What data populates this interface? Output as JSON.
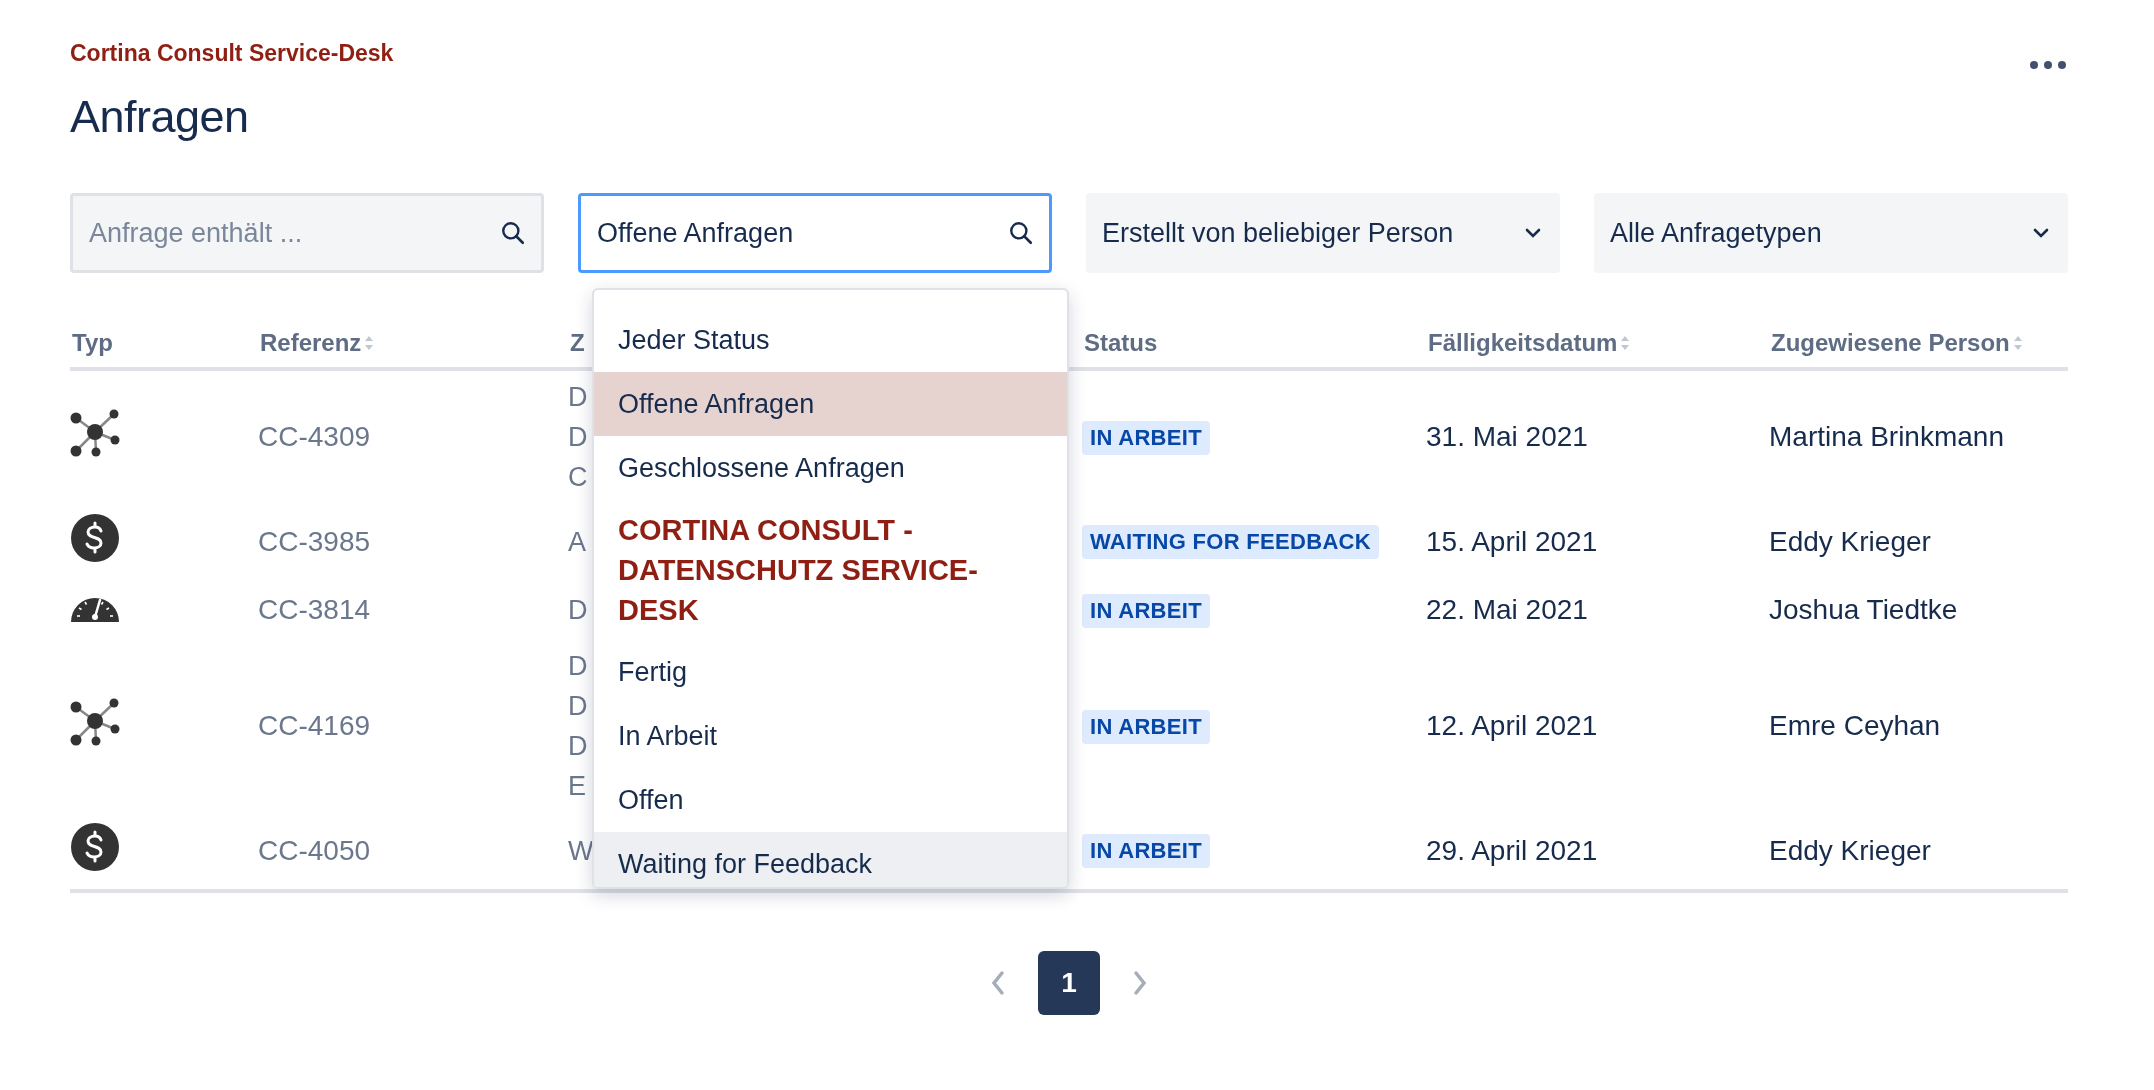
{
  "header": {
    "service_desk": "Cortina Consult Service-Desk",
    "title": "Anfragen"
  },
  "filters": [
    {
      "kind": "search",
      "placeholder": "Anfrage enthält ...",
      "focused": false
    },
    {
      "kind": "search",
      "value": "Offene Anfragen",
      "focused": true
    },
    {
      "kind": "select",
      "value": "Erstellt von beliebiger Person"
    },
    {
      "kind": "select",
      "value": "Alle Anfragetypen"
    }
  ],
  "status_dropdown": {
    "options": [
      {
        "kind": "option",
        "label": "Jeder Status",
        "selected": false,
        "highlighted": false
      },
      {
        "kind": "option",
        "label": "Offene Anfragen",
        "selected": true,
        "highlighted": false
      },
      {
        "kind": "option",
        "label": "Geschlossene Anfragen",
        "selected": false,
        "highlighted": false
      },
      {
        "kind": "group",
        "label": "CORTINA CONSULT - DATENSCHUTZ SERVICE-DESK",
        "selected": false,
        "highlighted": false
      },
      {
        "kind": "option",
        "label": "Fertig",
        "selected": false,
        "highlighted": false
      },
      {
        "kind": "option",
        "label": "In Arbeit",
        "selected": false,
        "highlighted": false
      },
      {
        "kind": "option",
        "label": "Offen",
        "selected": false,
        "highlighted": false
      },
      {
        "kind": "option",
        "label": "Waiting for Feedback",
        "selected": false,
        "highlighted": true
      }
    ]
  },
  "table": {
    "columns": [
      {
        "label": "Typ",
        "sortable": false
      },
      {
        "label": "Referenz",
        "sortable": true
      },
      {
        "label": "Z",
        "sortable": false
      },
      {
        "label": "Status",
        "sortable": false
      },
      {
        "label": "Fälligkeitsdatum",
        "sortable": true
      },
      {
        "label": "Zugewiesene Person",
        "sortable": true
      }
    ],
    "rows": [
      {
        "kind": "network",
        "reference": "CC-4309",
        "column_3": [
          "D",
          "D",
          "C"
        ],
        "status": "IN ARBEIT",
        "due": "31. Mai 2021",
        "assignee": "Martina Brinkmann"
      },
      {
        "kind": "dollar",
        "reference": "CC-3985",
        "column_3": [
          "A"
        ],
        "status": "WAITING FOR FEEDBACK",
        "due": "15. April 2021",
        "assignee": "Eddy Krieger"
      },
      {
        "kind": "gauge",
        "reference": "CC-3814",
        "column_3": [
          "D"
        ],
        "status": "IN ARBEIT",
        "due": "22. Mai 2021",
        "assignee": "Joshua Tiedtke"
      },
      {
        "kind": "network",
        "reference": "CC-4169",
        "column_3": [
          "D",
          "D",
          "D",
          "E"
        ],
        "status": "IN ARBEIT",
        "due": "12. April 2021",
        "assignee": "Emre Ceyhan"
      },
      {
        "kind": "dollar",
        "reference": "CC-4050",
        "column_3": [
          "W"
        ],
        "status": "IN ARBEIT",
        "due": "29. April 2021",
        "assignee": "Eddy Krieger"
      }
    ]
  },
  "pagination": {
    "pages": [
      {
        "label": "1",
        "selected": true
      }
    ]
  }
}
